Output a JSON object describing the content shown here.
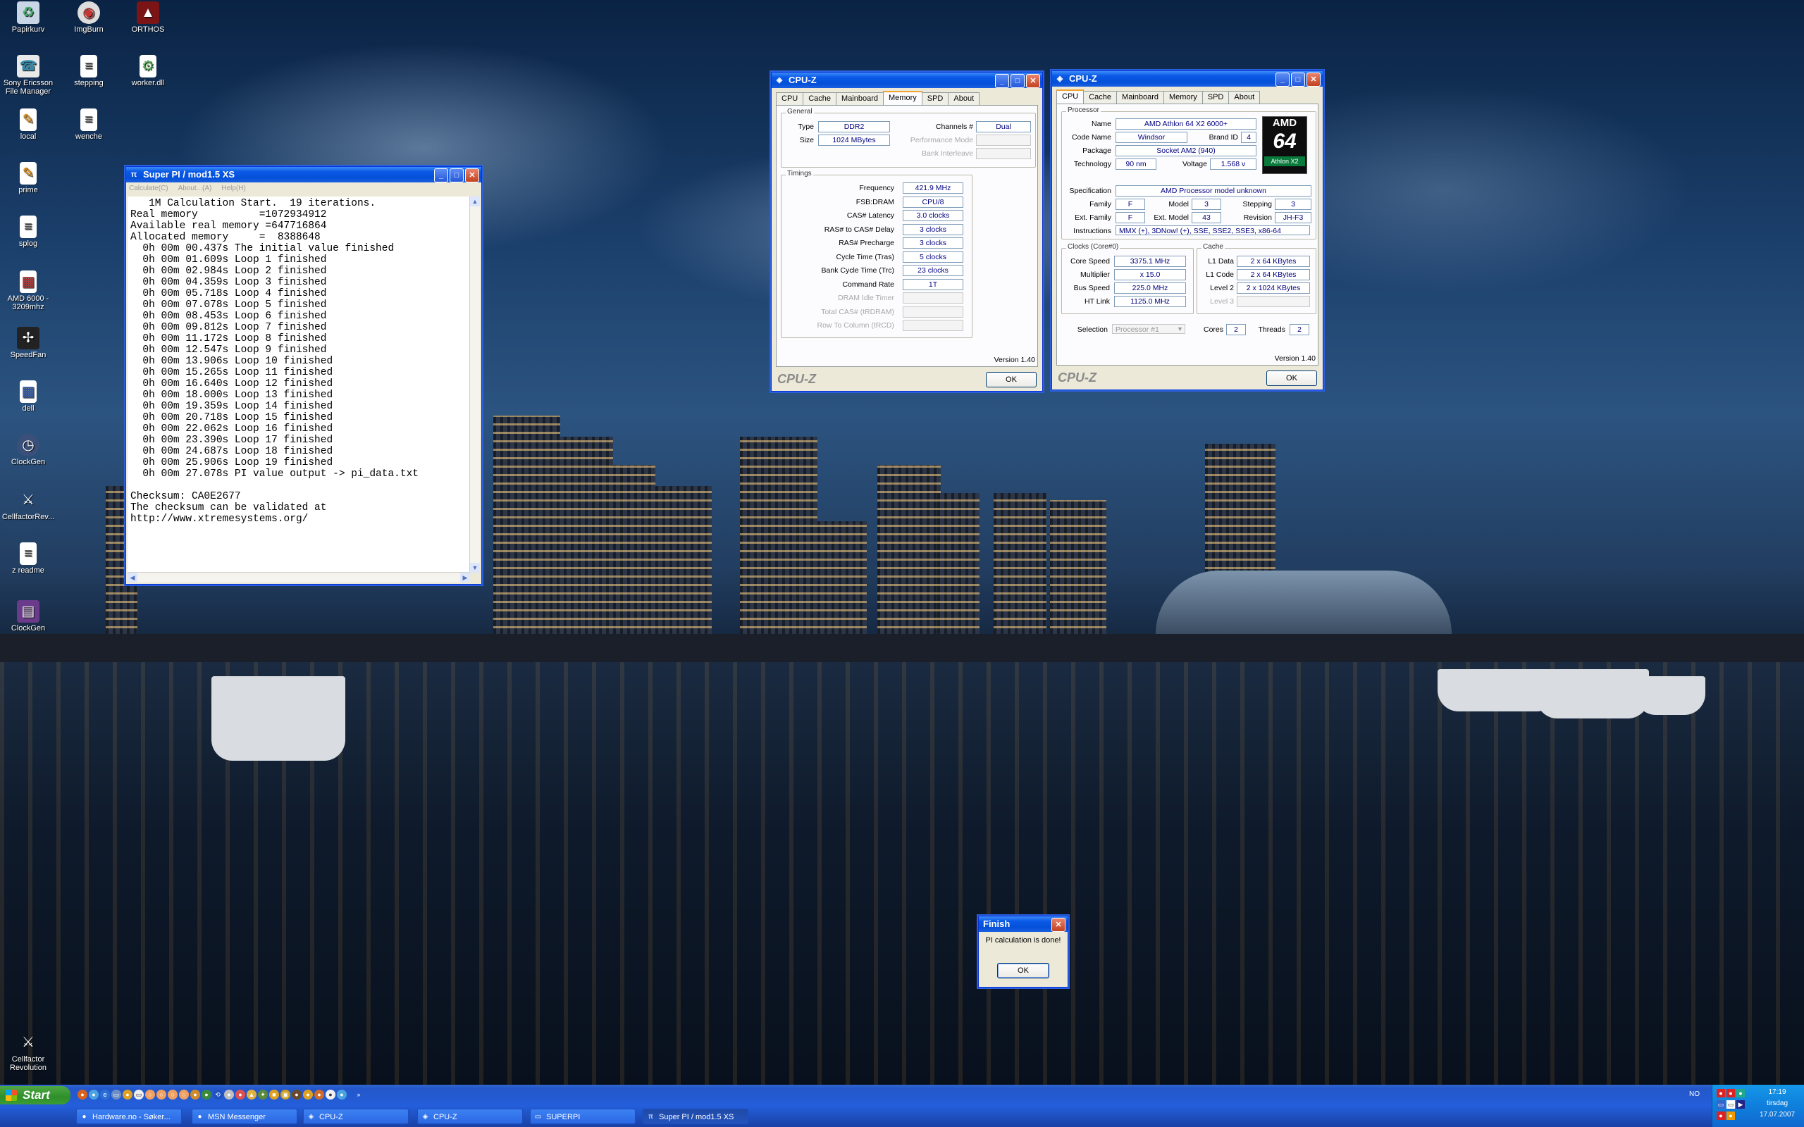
{
  "desktop_icons": [
    {
      "label": "Papirkurv",
      "icon": "recycle-bin-icon"
    },
    {
      "label": "ImgBurn",
      "icon": "disc-icon"
    },
    {
      "label": "ORTHOS",
      "icon": "orthos-icon"
    },
    {
      "label": "Sony Ericsson File Manager",
      "icon": "phone-icon"
    },
    {
      "label": "stepping",
      "icon": "text-file-icon"
    },
    {
      "label": "worker.dll",
      "icon": "dll-file-icon"
    },
    {
      "label": "local",
      "icon": "shortcut-icon"
    },
    {
      "label": "wenche",
      "icon": "text-file-icon"
    },
    {
      "label": "prime",
      "icon": "shortcut-icon"
    },
    {
      "label": "splog",
      "icon": "text-file-icon"
    },
    {
      "label": "AMD 6000 - 3209mhz",
      "icon": "image-file-icon"
    },
    {
      "label": "SpeedFan",
      "icon": "fan-icon"
    },
    {
      "label": "dell",
      "icon": "image-file-icon"
    },
    {
      "label": "ClockGen",
      "icon": "clock-icon"
    },
    {
      "label": "CellfactorRev...",
      "icon": "game-icon"
    },
    {
      "label": "z readme",
      "icon": "text-file-icon"
    },
    {
      "label": "ClockGen",
      "icon": "clockgen-icon"
    },
    {
      "label": "Cellfactor Revolution",
      "icon": "game-icon"
    }
  ],
  "superpi": {
    "title": "Super PI / mod1.5 XS",
    "menu": [
      "Calculate(C)",
      "About...(A)",
      "Help(H)"
    ],
    "output": "   1M Calculation Start.  19 iterations.\nReal memory          =1072934912\nAvailable real memory =647716864\nAllocated memory     =  8388648\n  0h 00m 00.437s The initial value finished\n  0h 00m 01.609s Loop 1 finished\n  0h 00m 02.984s Loop 2 finished\n  0h 00m 04.359s Loop 3 finished\n  0h 00m 05.718s Loop 4 finished\n  0h 00m 07.078s Loop 5 finished\n  0h 00m 08.453s Loop 6 finished\n  0h 00m 09.812s Loop 7 finished\n  0h 00m 11.172s Loop 8 finished\n  0h 00m 12.547s Loop 9 finished\n  0h 00m 13.906s Loop 10 finished\n  0h 00m 15.265s Loop 11 finished\n  0h 00m 16.640s Loop 12 finished\n  0h 00m 18.000s Loop 13 finished\n  0h 00m 19.359s Loop 14 finished\n  0h 00m 20.718s Loop 15 finished\n  0h 00m 22.062s Loop 16 finished\n  0h 00m 23.390s Loop 17 finished\n  0h 00m 24.687s Loop 18 finished\n  0h 00m 25.906s Loop 19 finished\n  0h 00m 27.078s PI value output -> pi_data.txt\n\nChecksum: CA0E2677\nThe checksum can be validated at\nhttp://www.xtremesystems.org/"
  },
  "cpuz_memory": {
    "title": "CPU-Z",
    "tabs": [
      "CPU",
      "Cache",
      "Mainboard",
      "Memory",
      "SPD",
      "About"
    ],
    "active_tab": "Memory",
    "general_label": "General",
    "type_label": "Type",
    "type": "DDR2",
    "size_label": "Size",
    "size": "1024 MBytes",
    "channels_label": "Channels #",
    "channels": "Dual",
    "perf_mode_label": "Performance Mode",
    "bank_interleave_label": "Bank Interleave",
    "timings_label": "Timings",
    "timings": [
      {
        "label": "Frequency",
        "value": "421.9 MHz"
      },
      {
        "label": "FSB:DRAM",
        "value": "CPU/8"
      },
      {
        "label": "CAS# Latency",
        "value": "3.0 clocks"
      },
      {
        "label": "RAS# to CAS# Delay",
        "value": "3 clocks"
      },
      {
        "label": "RAS# Precharge",
        "value": "3 clocks"
      },
      {
        "label": "Cycle Time (Tras)",
        "value": "5 clocks"
      },
      {
        "label": "Bank Cycle Time (Trc)",
        "value": "23 clocks"
      },
      {
        "label": "Command Rate",
        "value": "1T"
      }
    ],
    "timings_dim": [
      "DRAM Idle Timer",
      "Total CAS# (tRDRAM)",
      "Row To Column (tRCD)"
    ],
    "version": "Version 1.40",
    "logo": "CPU-Z",
    "ok": "OK"
  },
  "cpuz_cpu": {
    "title": "CPU-Z",
    "tabs": [
      "CPU",
      "Cache",
      "Mainboard",
      "Memory",
      "SPD",
      "About"
    ],
    "active_tab": "CPU",
    "processor_label": "Processor",
    "name_label": "Name",
    "name": "AMD Athlon 64 X2 6000+",
    "codename_label": "Code Name",
    "codename": "Windsor",
    "brandid_label": "Brand ID",
    "brandid": "4",
    "package_label": "Package",
    "package": "Socket AM2 (940)",
    "technology_label": "Technology",
    "technology": "90 nm",
    "voltage_label": "Voltage",
    "voltage": "1.568 v",
    "spec_label": "Specification",
    "spec": "AMD Processor model unknown",
    "family_label": "Family",
    "family": "F",
    "model_label": "Model",
    "model": "3",
    "stepping_label": "Stepping",
    "stepping": "3",
    "extfamily_label": "Ext. Family",
    "extfamily": "F",
    "extmodel_label": "Ext. Model",
    "extmodel": "43",
    "revision_label": "Revision",
    "revision": "JH-F3",
    "instructions_label": "Instructions",
    "instructions": "MMX (+), 3DNow! (+), SSE, SSE2, SSE3, x86-64",
    "logo_amd": "AMD",
    "logo_64": "64",
    "logo_sub": "Athlon X2",
    "clocks_label": "Clocks (Core#0)",
    "corespeed_label": "Core Speed",
    "corespeed": "3375.1 MHz",
    "multiplier_label": "Multiplier",
    "multiplier": "x 15.0",
    "busspeed_label": "Bus Speed",
    "busspeed": "225.0 MHz",
    "htlink_label": "HT Link",
    "htlink": "1125.0 MHz",
    "cache_label": "Cache",
    "l1data_label": "L1 Data",
    "l1data": "2 x 64 KBytes",
    "l1code_label": "L1 Code",
    "l1code": "2 x 64 KBytes",
    "level2_label": "Level 2",
    "level2": "2 x 1024 KBytes",
    "level3_label": "Level 3",
    "selection_label": "Selection",
    "selection": "Processor #1",
    "cores_label": "Cores",
    "cores": "2",
    "threads_label": "Threads",
    "threads": "2",
    "version": "Version 1.40",
    "logo": "CPU-Z",
    "ok": "OK"
  },
  "dialog": {
    "title": "Finish",
    "message": "PI calculation is done!",
    "ok": "OK"
  },
  "taskbar": {
    "start": "Start",
    "items": [
      "Hardware.no - Søker...",
      "MSN Messenger",
      "CPU-Z",
      "CPU-Z",
      "SUPERPI",
      "Super PI / mod1.5 XS"
    ],
    "active_item": "Super PI / mod1.5 XS",
    "lang": "NO",
    "time": "17:19",
    "day": "tirsdag",
    "date": "17.07.2007"
  }
}
